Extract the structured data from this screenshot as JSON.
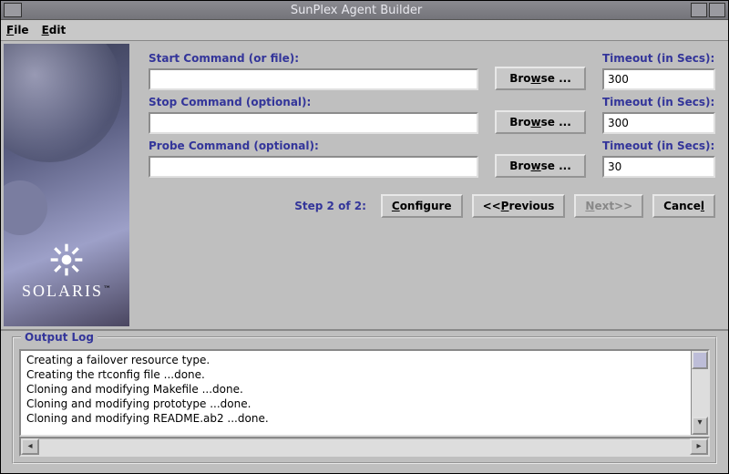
{
  "window": {
    "title": "SunPlex Agent Builder"
  },
  "menu": {
    "file": "File",
    "edit": "Edit"
  },
  "sidebar": {
    "brand": "SOLARIS",
    "tm": "™"
  },
  "form": {
    "start_label": "Start Command (or file):",
    "stop_label": "Stop Command (optional):",
    "probe_label": "Probe Command (optional):",
    "timeout_label": "Timeout (in Secs):",
    "start_value": "",
    "stop_value": "",
    "probe_value": "",
    "start_timeout": "300",
    "stop_timeout": "300",
    "probe_timeout": "30",
    "browse": "Browse ..."
  },
  "nav": {
    "step": "Step 2 of 2:",
    "configure": "Configure",
    "previous": "<<Previous",
    "next": "Next>>",
    "cancel": "Cancel"
  },
  "log": {
    "title": "Output Log",
    "lines": [
      "Creating a failover resource type.",
      "Creating the rtconfig file ...done.",
      "Cloning and modifying Makefile ...done.",
      "Cloning and modifying prototype ...done.",
      "Cloning and modifying README.ab2 ...done."
    ]
  }
}
